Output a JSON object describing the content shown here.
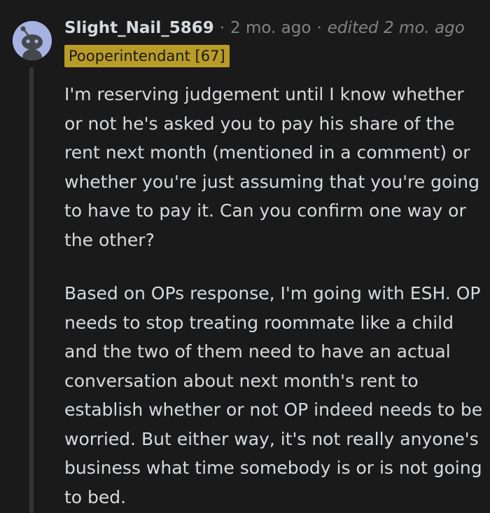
{
  "comment": {
    "username": "Slight_Nail_5869",
    "separator": "·",
    "timestamp": "2 mo. ago",
    "edited": "edited 2 mo. ago",
    "flair": "Pooperintendant [67]",
    "avatar_icon": "snoo-avatar-icon",
    "paragraphs": [
      "I'm reserving judgement until I know whether or not he's asked you to pay his share of the rent next month (mentioned in a comment) or whether you're just assuming that you're going to have to pay it. Can you confirm one way or the other?",
      "Based on OPs response, I'm going with ESH. OP needs to stop treating roommate like a child and the two of them need to have an actual conversation about next month's rent to establish whether or not OP indeed needs to be worried. But either way, it's not really anyone's business what time somebody is or is not going to bed."
    ]
  },
  "colors": {
    "background": "#1a1a1b",
    "text": "#d7dadc",
    "meta": "#818384",
    "flair_bg": "#b99c27",
    "thread_line": "#343536",
    "avatar_bg": "#a6b3e0"
  }
}
